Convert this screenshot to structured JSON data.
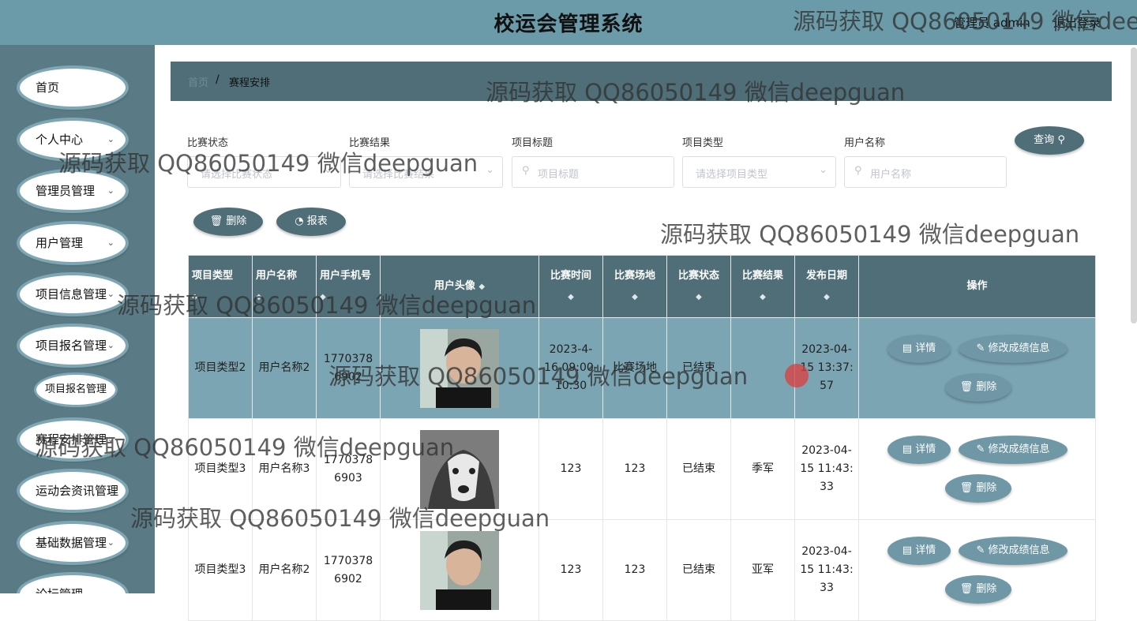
{
  "header": {
    "title": "校运会管理系统",
    "admin": "管理员 admin",
    "logout": "退出登录"
  },
  "sidebar": {
    "items": [
      {
        "label": "首页",
        "chevron": ""
      },
      {
        "label": "个人中心",
        "chevron": "⌄"
      },
      {
        "label": "管理员管理",
        "chevron": "⌄"
      },
      {
        "label": "用户管理",
        "chevron": "⌄"
      },
      {
        "label": "项目信息管理",
        "chevron": "⌄"
      },
      {
        "label": "项目报名管理",
        "chevron": "⌄"
      },
      {
        "label": "赛程安排管理",
        "chevron": "⌄"
      },
      {
        "label": "运动会资讯管理",
        "chevron": "⌄"
      },
      {
        "label": "基础数据管理",
        "chevron": "⌄"
      },
      {
        "label": "论坛管理",
        "chevron": "⌄"
      }
    ],
    "sub": "项目报名管理"
  },
  "breadcrumb": {
    "home": "首页",
    "sep": "/",
    "current": "赛程安排"
  },
  "filters": [
    {
      "label": "比赛状态",
      "placeholder": "请选择比赛状态",
      "type": "select"
    },
    {
      "label": "比赛结果",
      "placeholder": "请选择比赛结果",
      "type": "select"
    },
    {
      "label": "项目标题",
      "placeholder": "项目标题",
      "type": "input"
    },
    {
      "label": "项目类型",
      "placeholder": "请选择项目类型",
      "type": "select"
    },
    {
      "label": "用户名称",
      "placeholder": "用户名称",
      "type": "input"
    }
  ],
  "buttons": {
    "query": "查询",
    "delete": "删除",
    "report": "报表"
  },
  "table": {
    "columns": [
      "项目类型",
      "用户名称",
      "用户手机号",
      "用户头像",
      "比赛时间",
      "比赛场地",
      "比赛状态",
      "比赛结果",
      "发布日期",
      "操作"
    ],
    "rows": [
      {
        "type": "项目类型2",
        "user": "用户名称2",
        "phone": "17703786902",
        "avatar": "man-portrait",
        "time": "2023-4-16 09:00-10:30",
        "venue": "比赛场地",
        "status": "已结束",
        "result": "",
        "date": "2023-04-15 13:37:57"
      },
      {
        "type": "项目类型3",
        "user": "用户名称3",
        "phone": "17703786903",
        "avatar": "husky-dog",
        "time": "123",
        "venue": "123",
        "status": "已结束",
        "result": "季军",
        "date": "2023-04-15 11:43:33"
      },
      {
        "type": "项目类型3",
        "user": "用户名称2",
        "phone": "17703786902",
        "avatar": "man-portrait",
        "time": "123",
        "venue": "123",
        "status": "已结束",
        "result": "亚军",
        "date": "2023-04-15 11:43:33"
      }
    ],
    "ops": {
      "detail": "详情",
      "edit": "修改成绩信息",
      "delete": "删除"
    }
  },
  "watermark": "源码获取 QQ86050149 微信deepguan",
  "icons": {
    "chevron": "chevron-down-icon",
    "search": "search-icon",
    "trash": "trash-icon",
    "chart": "chart-icon",
    "doc": "document-icon",
    "edit": "edit-icon",
    "sort": "sort-icon"
  },
  "colors": {
    "header": "#6b9aa8",
    "sidebar": "#5a7b85",
    "primary": "#4f6e78",
    "highlight_row": "#7ba5b3"
  }
}
